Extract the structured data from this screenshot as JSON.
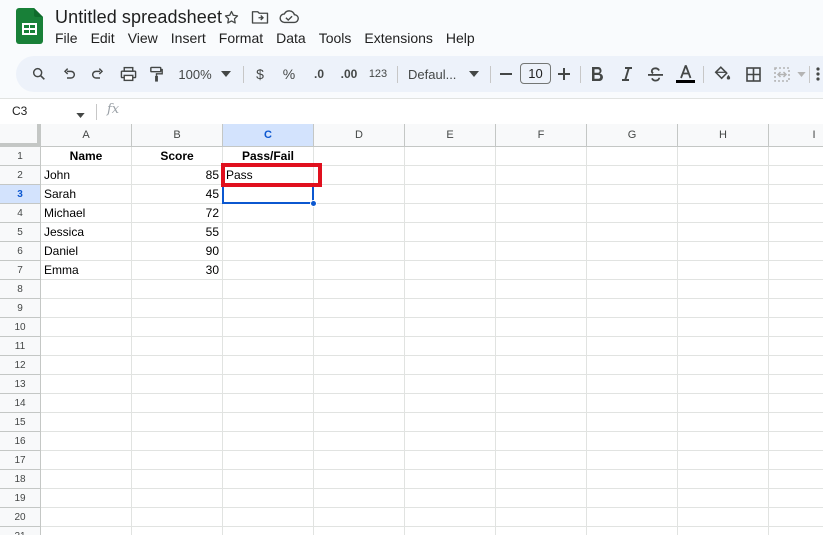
{
  "app": {
    "title": "Untitled spreadsheet",
    "brand_color": "#188038",
    "icons": [
      "star-icon",
      "move-to-folder-icon",
      "cloud-saved-icon"
    ]
  },
  "menu": [
    "File",
    "Edit",
    "View",
    "Insert",
    "Format",
    "Data",
    "Tools",
    "Extensions",
    "Help"
  ],
  "toolbar": {
    "zoom": "100%",
    "currency": "$",
    "percent": "%",
    "decrease_decimal": ".0",
    "increase_decimal": ".00",
    "number_format": "123",
    "font": "Defaul...",
    "font_size": "10",
    "icons": [
      "search-icon",
      "undo-icon",
      "redo-icon",
      "print-icon",
      "paint-format-icon",
      "minus-icon",
      "plus-icon",
      "bold-icon",
      "italic-icon",
      "strikethrough-icon",
      "text-color-icon",
      "fill-color-icon",
      "borders-icon",
      "merge-cells-icon",
      "more-icon"
    ]
  },
  "formula_bar": {
    "name_box": "C3",
    "fx": "fx",
    "content": ""
  },
  "sheet": {
    "columns": [
      "A",
      "B",
      "C",
      "D",
      "E",
      "F",
      "G",
      "H",
      "I"
    ],
    "rows": [
      "1",
      "2",
      "3",
      "4",
      "5",
      "6",
      "7",
      "8",
      "9",
      "10",
      "11",
      "12",
      "13",
      "14",
      "15",
      "16",
      "17",
      "18",
      "19",
      "20",
      "21"
    ],
    "selected_cell": "C3",
    "headers": [
      "Name",
      "Score",
      "Pass/Fail"
    ],
    "data": [
      {
        "name": "John",
        "score": "85",
        "result": "Pass"
      },
      {
        "name": "Sarah",
        "score": "45",
        "result": ""
      },
      {
        "name": "Michael",
        "score": "72",
        "result": ""
      },
      {
        "name": "Jessica",
        "score": "55",
        "result": ""
      },
      {
        "name": "Daniel",
        "score": "90",
        "result": ""
      },
      {
        "name": "Emma",
        "score": "30",
        "result": ""
      }
    ],
    "highlight_color": "#e0101e",
    "selection_color": "#0b57d0"
  }
}
